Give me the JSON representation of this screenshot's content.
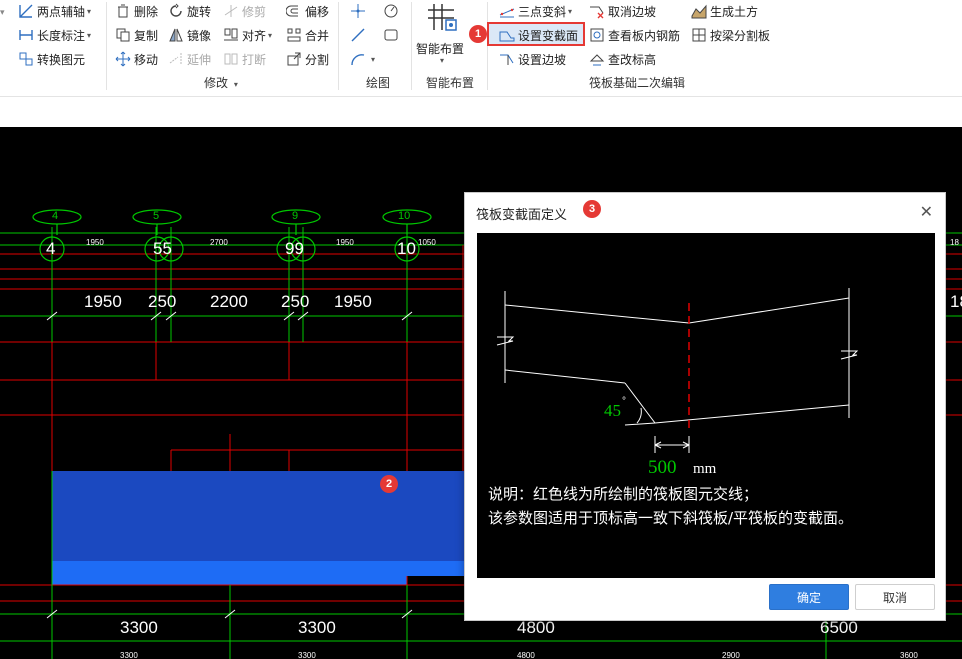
{
  "ribbon": {
    "col1": [
      {
        "label": "两点辅轴",
        "icon": "axis-two-point-icon",
        "caret": true
      },
      {
        "label": "长度标注",
        "icon": "dimension-icon",
        "caret": true
      },
      {
        "label": "转换图元",
        "icon": "convert-element-icon",
        "caret": false
      }
    ],
    "modify": {
      "items": [
        {
          "label": "删除",
          "icon": "delete-icon",
          "disabled": false
        },
        {
          "label": "旋转",
          "icon": "rotate-icon",
          "disabled": false
        },
        {
          "label": "修剪",
          "icon": "trim-icon",
          "disabled": true
        },
        {
          "label": "偏移",
          "icon": "offset-icon",
          "disabled": false
        },
        {
          "label": "复制",
          "icon": "copy-icon",
          "disabled": false
        },
        {
          "label": "镜像",
          "icon": "mirror-icon",
          "disabled": false
        },
        {
          "label": "对齐",
          "icon": "align-icon",
          "disabled": false
        },
        {
          "label": "合并",
          "icon": "merge-icon",
          "disabled": false
        },
        {
          "label": "移动",
          "icon": "move-icon",
          "disabled": false
        },
        {
          "label": "延伸",
          "icon": "extend-icon",
          "disabled": true
        },
        {
          "label": "打断",
          "icon": "break-icon",
          "disabled": true
        },
        {
          "label": "分割",
          "icon": "split-icon",
          "disabled": false
        }
      ],
      "group_label": "修改"
    },
    "draw": {
      "group_label": "绘图"
    },
    "smart": {
      "button_label": "智能布置",
      "group_label": "智能布置"
    },
    "raft": {
      "items": [
        {
          "label": "三点变斜",
          "icon": "three-point-slope-icon"
        },
        {
          "label": "取消边坡",
          "icon": "cancel-slope-icon"
        },
        {
          "label": "生成土方",
          "icon": "generate-earthwork-icon"
        },
        {
          "label": "设置变截面",
          "icon": "variable-section-icon"
        },
        {
          "label": "查看板内钢筋",
          "icon": "view-rebar-icon"
        },
        {
          "label": "按梁分割板",
          "icon": "split-by-beam-icon"
        },
        {
          "label": "设置边坡",
          "icon": "set-slope-icon"
        },
        {
          "label": "查改标高",
          "icon": "elevation-icon"
        }
      ],
      "group_label": "筏板基础二次编辑"
    },
    "badge1": "1"
  },
  "canvas": {
    "axis_bubbles": [
      "4",
      "5",
      "9",
      "10"
    ],
    "axis_labels": [
      "4",
      "55",
      "99",
      "10"
    ],
    "small_dims_top": [
      "1950",
      "2700",
      "1950",
      "1050"
    ],
    "mid_dims": [
      "1950",
      "250",
      "2200",
      "250",
      "1950"
    ],
    "bottom_dims": [
      "3300",
      "3300",
      "4800",
      "6500"
    ],
    "bottom_small_dims": [
      "3300",
      "3300",
      "4800",
      "2900",
      "3600"
    ],
    "right_edge_text": [
      "18",
      "18"
    ],
    "badge2": "2"
  },
  "dialog": {
    "title": "筏板变截面定义",
    "badge3": "3",
    "angle": "45",
    "degree": "°",
    "width_value": "500",
    "width_unit": "mm",
    "note_line1": "说明：红色线为所绘制的筏板图元交线；",
    "note_line2": "该参数图适用于顶标高一致下斜筏板/平筏板的变截面。",
    "ok_label": "确定",
    "cancel_label": "取消"
  },
  "colors": {
    "accent": "#2f7ee0",
    "highlight": "#e53935",
    "cad_green": "#00c800",
    "cad_red": "#e00000",
    "cad_blue": "#1e4fc8"
  }
}
